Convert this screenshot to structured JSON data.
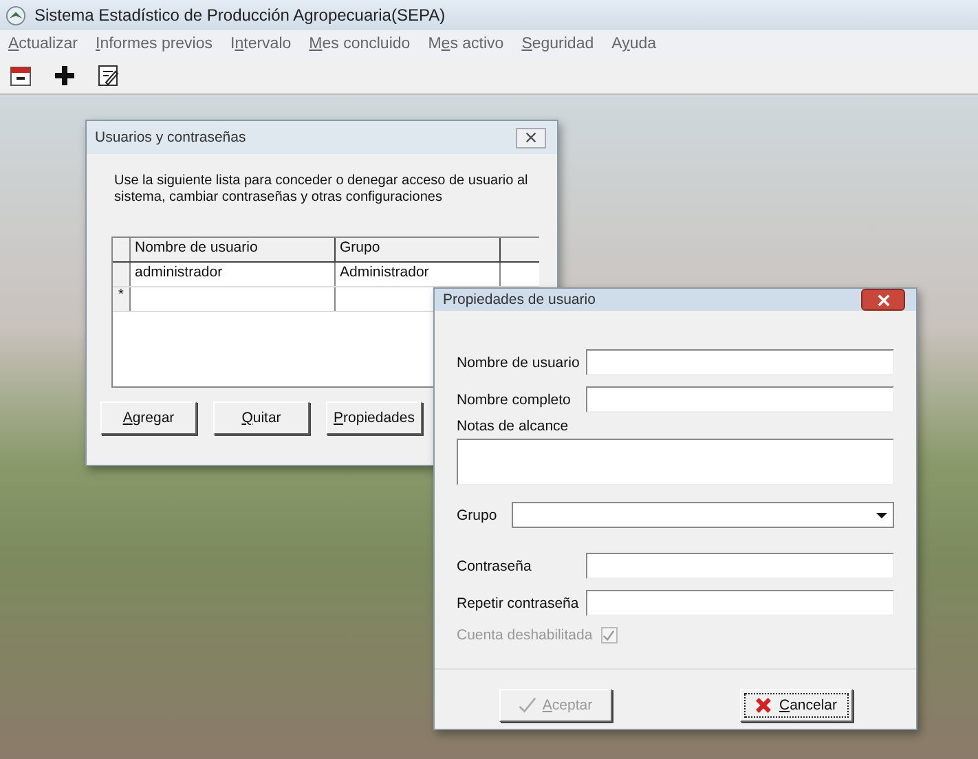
{
  "window": {
    "title": "Sistema Estadístico de Producción Agropecuaria(SEPA)"
  },
  "menu": [
    {
      "key": "A",
      "rest": "ctualizar"
    },
    {
      "key": "I",
      "rest": "nformes previos"
    },
    {
      "lead": "I",
      "key": "n",
      "rest": "tervalo"
    },
    {
      "key": "M",
      "rest": "es concluido"
    },
    {
      "lead": "M",
      "key": "e",
      "rest": "s activo"
    },
    {
      "key": "S",
      "rest": "eguridad"
    },
    {
      "lead": "A",
      "key": "y",
      "rest": "uda"
    }
  ],
  "users_dialog": {
    "title": "Usuarios y contraseñas",
    "description": "Use la siguiente lista para conceder o denegar acceso de usuario al sistema, cambiar contraseñas y otras configuraciones",
    "table": {
      "columns": [
        "Nombre de usuario",
        "Grupo"
      ],
      "rows": [
        {
          "cells": [
            "administrador",
            "Administrador"
          ]
        },
        {
          "marker": "*"
        }
      ]
    },
    "buttons": [
      {
        "key": "A",
        "rest": "gregar"
      },
      {
        "key": "Q",
        "rest": "uitar"
      },
      {
        "key": "P",
        "rest": "ropiedades"
      }
    ]
  },
  "properties_dialog": {
    "title": "Propiedades de usuario",
    "fields": [
      {
        "kind": "text",
        "label": "Nombre de usuario"
      },
      {
        "kind": "text",
        "label": "Nombre completo"
      },
      {
        "kind": "area",
        "label": "Notas de alcance"
      },
      {
        "kind": "select",
        "label": "Grupo"
      },
      {
        "kind": "text",
        "label": "Contraseña"
      },
      {
        "kind": "text",
        "label": "Repetir contraseña"
      }
    ],
    "checkbox": {
      "label": "Cuenta deshabilitada",
      "checked": true,
      "disabled": true
    },
    "buttons": [
      {
        "kind": "accept",
        "key": "A",
        "rest": "ceptar",
        "disabled": true,
        "focused": false
      },
      {
        "kind": "cancel",
        "key": "C",
        "rest": "ancelar",
        "disabled": false,
        "focused": true
      }
    ]
  }
}
